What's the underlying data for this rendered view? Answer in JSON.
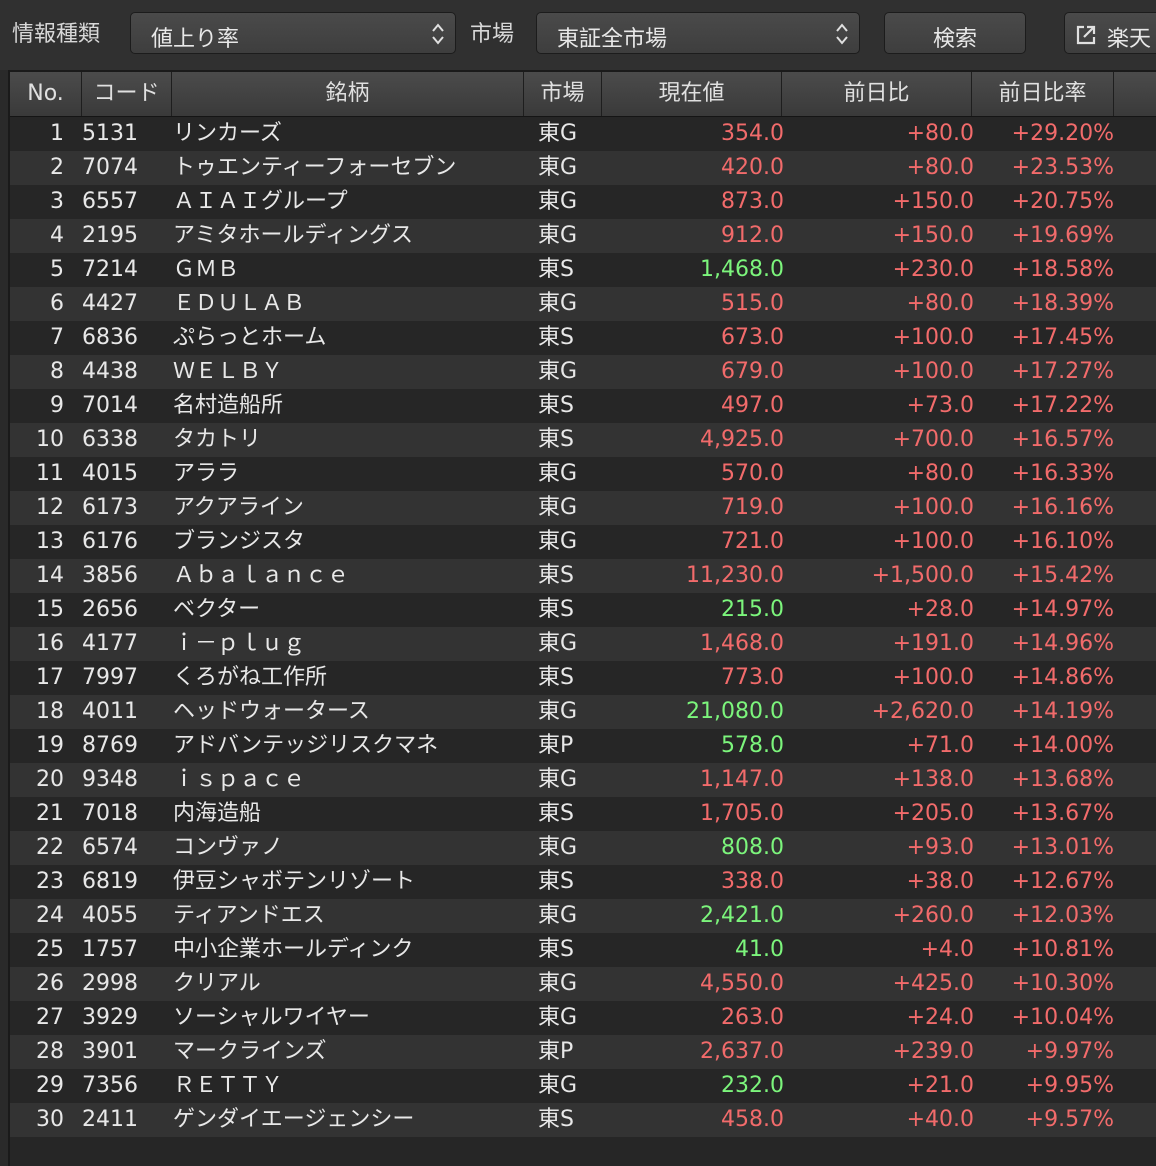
{
  "toolbar": {
    "info_type_label": "情報種類",
    "info_type_value": "値上り率",
    "market_label": "市場",
    "market_value": "東証全市場",
    "search_label": "検索",
    "rakuten_label": "楽天"
  },
  "colors": {
    "up": "#f26b6b",
    "highlight": "#7cf57c"
  },
  "table": {
    "headers": [
      "No.",
      "コード",
      "銘柄",
      "市場",
      "現在値",
      "前日比",
      "前日比率"
    ],
    "rows": [
      {
        "no": "1",
        "code": "5131",
        "name": "リンカーズ",
        "market": "東G",
        "price": "354.0",
        "price_color": "red",
        "change": "+80.0",
        "pct": "+29.20%"
      },
      {
        "no": "2",
        "code": "7074",
        "name": "トゥエンティーフォーセブン",
        "market": "東G",
        "price": "420.0",
        "price_color": "red",
        "change": "+80.0",
        "pct": "+23.53%"
      },
      {
        "no": "3",
        "code": "6557",
        "name": "ＡＩＡＩグループ",
        "market": "東G",
        "price": "873.0",
        "price_color": "red",
        "change": "+150.0",
        "pct": "+20.75%"
      },
      {
        "no": "4",
        "code": "2195",
        "name": "アミタホールディングス",
        "market": "東G",
        "price": "912.0",
        "price_color": "red",
        "change": "+150.0",
        "pct": "+19.69%"
      },
      {
        "no": "5",
        "code": "7214",
        "name": "ＧＭＢ",
        "market": "東S",
        "price": "1,468.0",
        "price_color": "green",
        "change": "+230.0",
        "pct": "+18.58%"
      },
      {
        "no": "6",
        "code": "4427",
        "name": "ＥＤＵＬＡＢ",
        "market": "東G",
        "price": "515.0",
        "price_color": "red",
        "change": "+80.0",
        "pct": "+18.39%"
      },
      {
        "no": "7",
        "code": "6836",
        "name": "ぷらっとホーム",
        "market": "東S",
        "price": "673.0",
        "price_color": "red",
        "change": "+100.0",
        "pct": "+17.45%"
      },
      {
        "no": "8",
        "code": "4438",
        "name": "ＷＥＬＢＹ",
        "market": "東G",
        "price": "679.0",
        "price_color": "red",
        "change": "+100.0",
        "pct": "+17.27%"
      },
      {
        "no": "9",
        "code": "7014",
        "name": "名村造船所",
        "market": "東S",
        "price": "497.0",
        "price_color": "red",
        "change": "+73.0",
        "pct": "+17.22%"
      },
      {
        "no": "10",
        "code": "6338",
        "name": "タカトリ",
        "market": "東S",
        "price": "4,925.0",
        "price_color": "red",
        "change": "+700.0",
        "pct": "+16.57%"
      },
      {
        "no": "11",
        "code": "4015",
        "name": "アララ",
        "market": "東G",
        "price": "570.0",
        "price_color": "red",
        "change": "+80.0",
        "pct": "+16.33%"
      },
      {
        "no": "12",
        "code": "6173",
        "name": "アクアライン",
        "market": "東G",
        "price": "719.0",
        "price_color": "red",
        "change": "+100.0",
        "pct": "+16.16%"
      },
      {
        "no": "13",
        "code": "6176",
        "name": "ブランジスタ",
        "market": "東G",
        "price": "721.0",
        "price_color": "red",
        "change": "+100.0",
        "pct": "+16.10%"
      },
      {
        "no": "14",
        "code": "3856",
        "name": "Ａｂａｌａｎｃｅ",
        "market": "東S",
        "price": "11,230.0",
        "price_color": "red",
        "change": "+1,500.0",
        "pct": "+15.42%"
      },
      {
        "no": "15",
        "code": "2656",
        "name": "ベクター",
        "market": "東S",
        "price": "215.0",
        "price_color": "green",
        "change": "+28.0",
        "pct": "+14.97%"
      },
      {
        "no": "16",
        "code": "4177",
        "name": "ｉ－ｐｌｕｇ",
        "market": "東G",
        "price": "1,468.0",
        "price_color": "red",
        "change": "+191.0",
        "pct": "+14.96%"
      },
      {
        "no": "17",
        "code": "7997",
        "name": "くろがね工作所",
        "market": "東S",
        "price": "773.0",
        "price_color": "red",
        "change": "+100.0",
        "pct": "+14.86%"
      },
      {
        "no": "18",
        "code": "4011",
        "name": "ヘッドウォータース",
        "market": "東G",
        "price": "21,080.0",
        "price_color": "green",
        "change": "+2,620.0",
        "pct": "+14.19%"
      },
      {
        "no": "19",
        "code": "8769",
        "name": "アドバンテッジリスクマネ",
        "market": "東P",
        "price": "578.0",
        "price_color": "green",
        "change": "+71.0",
        "pct": "+14.00%"
      },
      {
        "no": "20",
        "code": "9348",
        "name": "ｉｓｐａｃｅ",
        "market": "東G",
        "price": "1,147.0",
        "price_color": "red",
        "change": "+138.0",
        "pct": "+13.68%"
      },
      {
        "no": "21",
        "code": "7018",
        "name": "内海造船",
        "market": "東S",
        "price": "1,705.0",
        "price_color": "red",
        "change": "+205.0",
        "pct": "+13.67%"
      },
      {
        "no": "22",
        "code": "6574",
        "name": "コンヴァノ",
        "market": "東G",
        "price": "808.0",
        "price_color": "green",
        "change": "+93.0",
        "pct": "+13.01%"
      },
      {
        "no": "23",
        "code": "6819",
        "name": "伊豆シャボテンリゾート",
        "market": "東S",
        "price": "338.0",
        "price_color": "red",
        "change": "+38.0",
        "pct": "+12.67%"
      },
      {
        "no": "24",
        "code": "4055",
        "name": "ティアンドエス",
        "market": "東G",
        "price": "2,421.0",
        "price_color": "green",
        "change": "+260.0",
        "pct": "+12.03%"
      },
      {
        "no": "25",
        "code": "1757",
        "name": "中小企業ホールディンク",
        "market": "東S",
        "price": "41.0",
        "price_color": "green",
        "change": "+4.0",
        "pct": "+10.81%"
      },
      {
        "no": "26",
        "code": "2998",
        "name": "クリアル",
        "market": "東G",
        "price": "4,550.0",
        "price_color": "red",
        "change": "+425.0",
        "pct": "+10.30%"
      },
      {
        "no": "27",
        "code": "3929",
        "name": "ソーシャルワイヤー",
        "market": "東G",
        "price": "263.0",
        "price_color": "red",
        "change": "+24.0",
        "pct": "+10.04%"
      },
      {
        "no": "28",
        "code": "3901",
        "name": "マークラインズ",
        "market": "東P",
        "price": "2,637.0",
        "price_color": "red",
        "change": "+239.0",
        "pct": "+9.97%"
      },
      {
        "no": "29",
        "code": "7356",
        "name": "ＲＥＴＴＹ",
        "market": "東G",
        "price": "232.0",
        "price_color": "green",
        "change": "+21.0",
        "pct": "+9.95%"
      },
      {
        "no": "30",
        "code": "2411",
        "name": "ゲンダイエージェンシー",
        "market": "東S",
        "price": "458.0",
        "price_color": "red",
        "change": "+40.0",
        "pct": "+9.57%"
      }
    ]
  }
}
